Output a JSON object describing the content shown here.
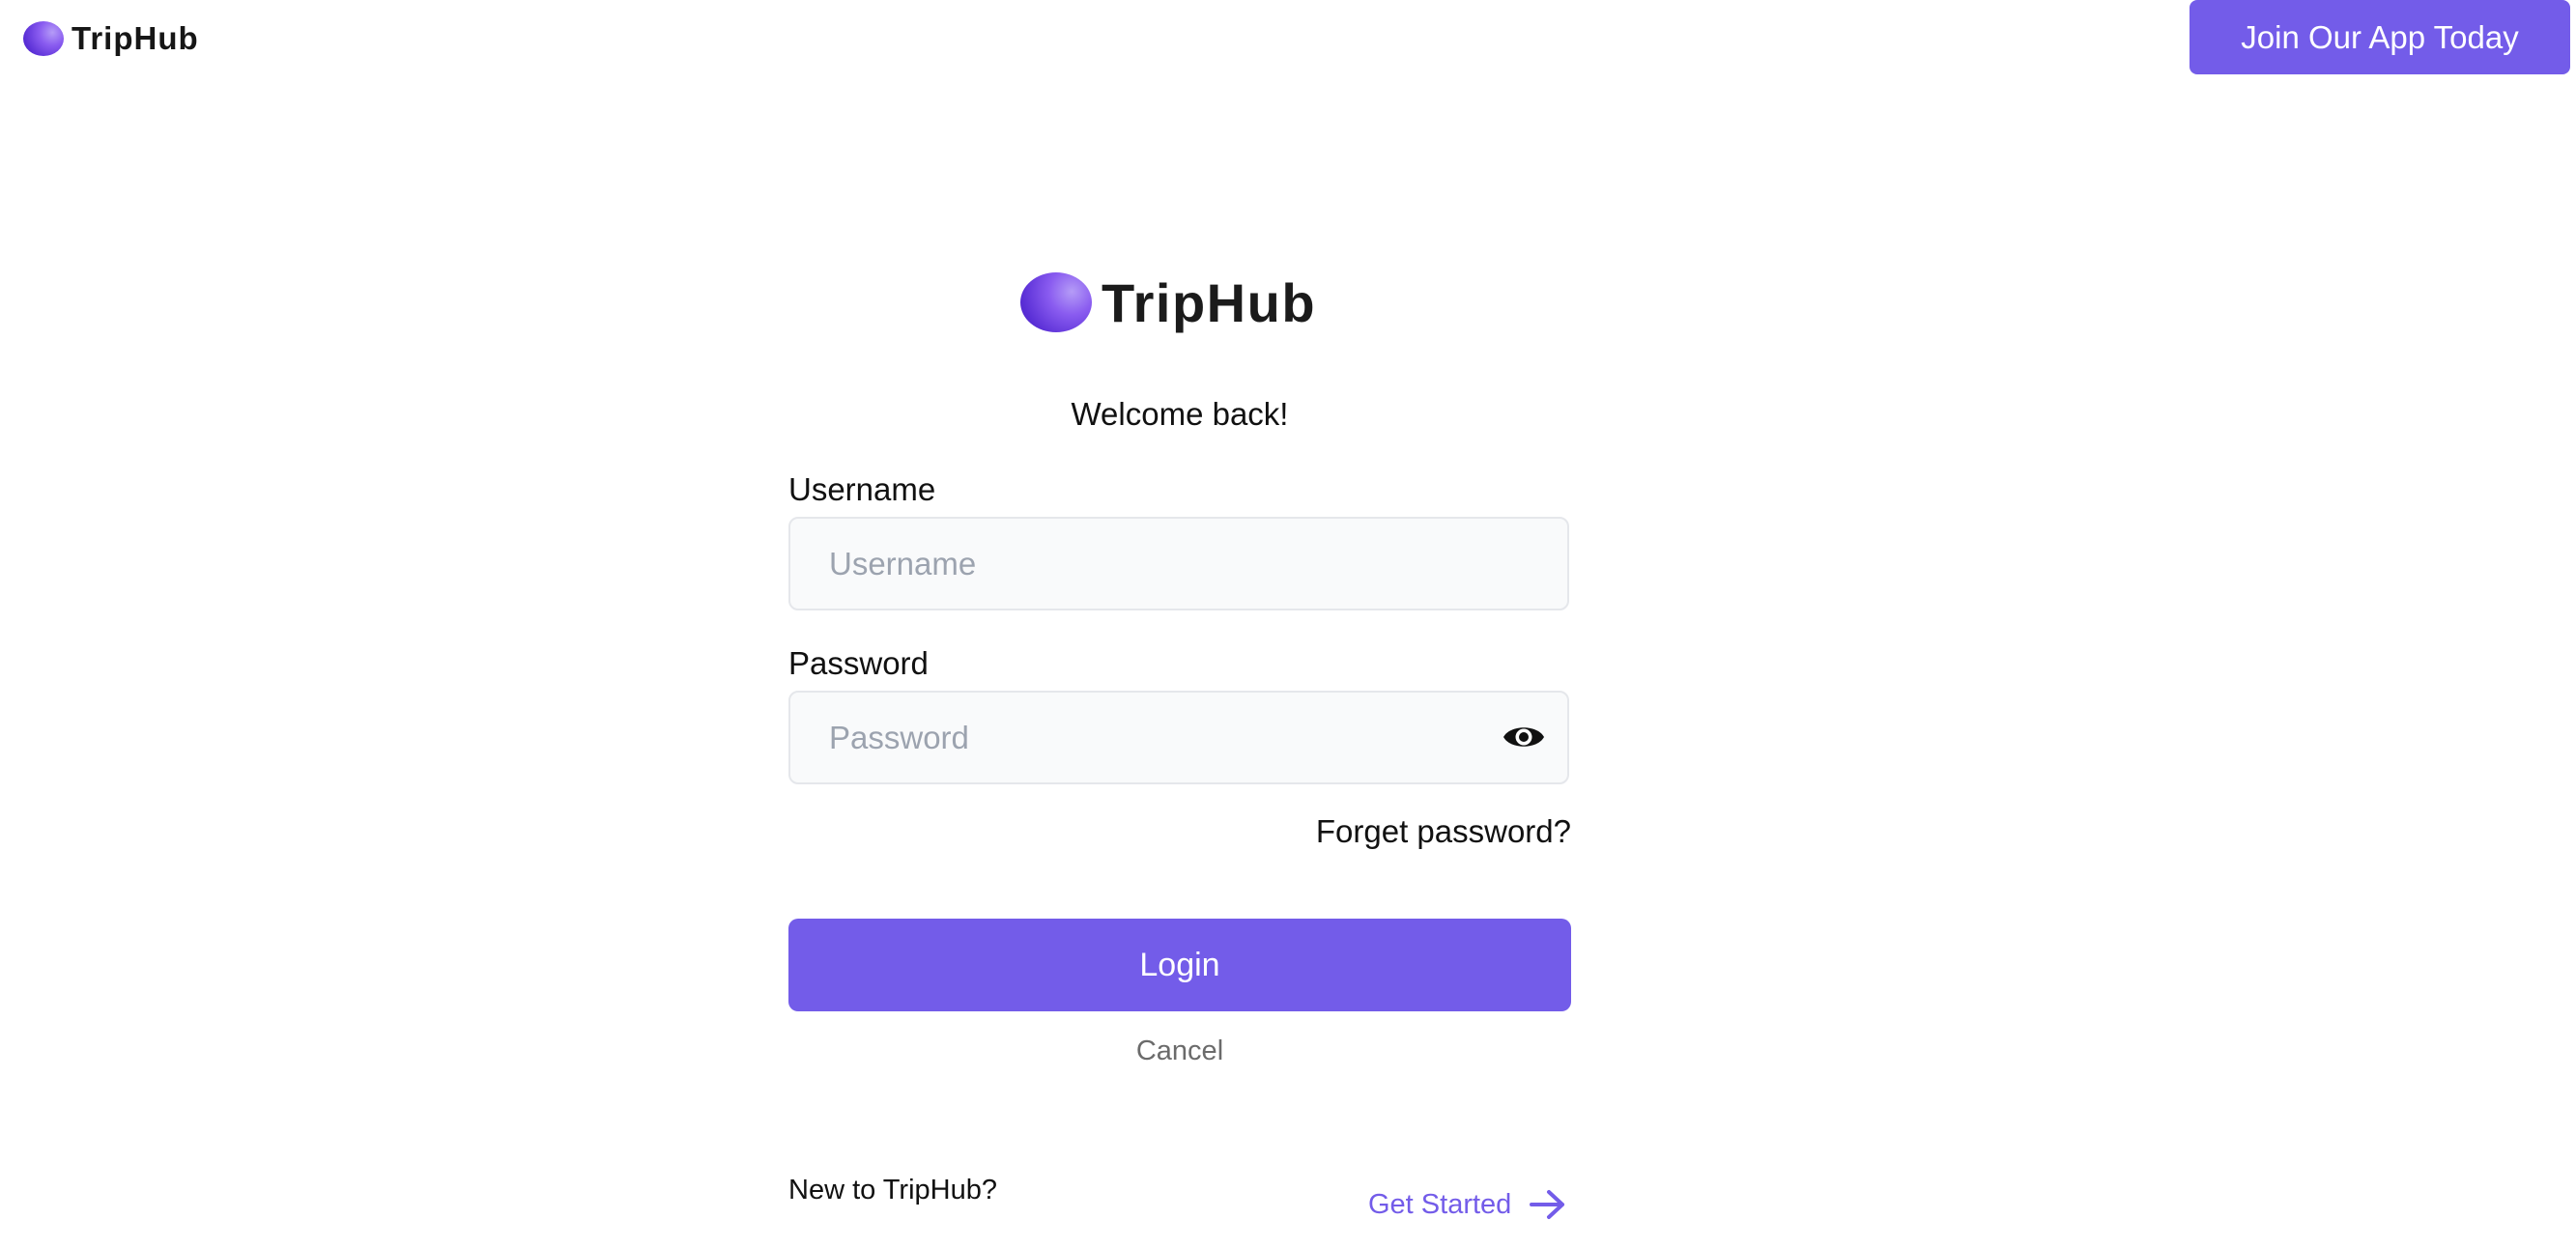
{
  "brand": {
    "name": "TripHub",
    "accent_color": "#735ce9"
  },
  "header": {
    "join_label": "Join Our App Today"
  },
  "login": {
    "welcome": "Welcome back!",
    "username_label": "Username",
    "username_placeholder": "Username",
    "username_value": "",
    "password_label": "Password",
    "password_placeholder": "Password",
    "password_value": "",
    "password_toggle_icon": "eye-icon",
    "forgot_label": "Forget password?",
    "login_label": "Login",
    "cancel_label": "Cancel"
  },
  "footer": {
    "new_text": "New to TripHub?",
    "get_started_label": "Get Started",
    "get_started_icon": "arrow-right-icon"
  }
}
